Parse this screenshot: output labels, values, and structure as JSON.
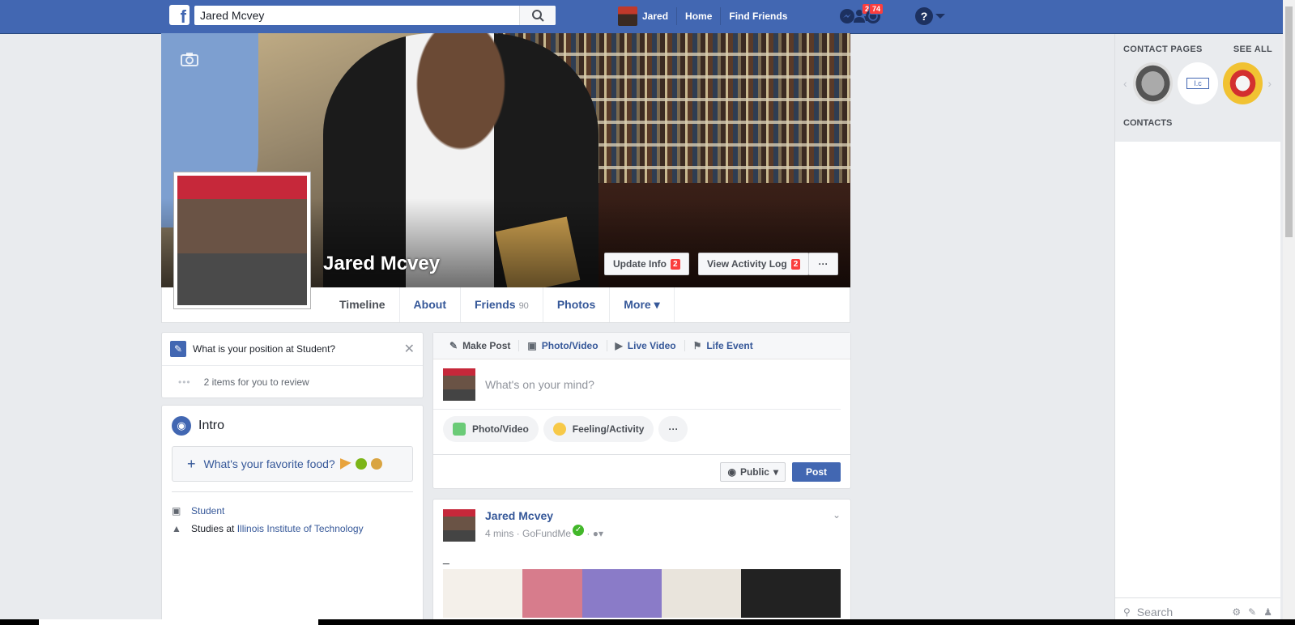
{
  "topbar": {
    "logo": "f",
    "search_value": "Jared Mcvey",
    "user_name": "Jared",
    "home": "Home",
    "find_friends": "Find Friends",
    "friend_requests_count": "2",
    "notifications_count": "74",
    "help": "?"
  },
  "cover": {
    "name": "Jared Mcvey",
    "update_info": "Update Info",
    "update_info_count": "2",
    "activity_log": "View Activity Log",
    "activity_log_count": "2",
    "more": "···"
  },
  "tabs": [
    {
      "label": "Timeline"
    },
    {
      "label": "About"
    },
    {
      "label": "Friends",
      "count": "90"
    },
    {
      "label": "Photos"
    },
    {
      "label": "More ▾"
    }
  ],
  "review": {
    "question": "What is your position at Student?",
    "items": "2 items for you to review"
  },
  "intro": {
    "title": "Intro",
    "fav_food": "What's your favorite food?",
    "job": "Student",
    "studies_prefix": "Studies at ",
    "school": "Illinois Institute of Technology"
  },
  "composer": {
    "tabs": [
      "Make Post",
      "Photo/Video",
      "Live Video",
      "Life Event"
    ],
    "placeholder": "What's on your mind?",
    "photo_video": "Photo/Video",
    "feeling": "Feeling/Activity",
    "more": "···",
    "privacy": "Public",
    "post": "Post"
  },
  "post": {
    "author": "Jared Mcvey",
    "time": "4 mins",
    "source": "GoFundMe",
    "text": "_"
  },
  "right_panel": {
    "contact_pages": "CONTACT PAGES",
    "see_all": "SEE ALL",
    "page_b_label": "I.c",
    "contacts": "CONTACTS",
    "search_placeholder": "Search"
  },
  "colors": {
    "brand": "#4267b2",
    "badge": "#fa3e3e",
    "link": "#365899"
  }
}
